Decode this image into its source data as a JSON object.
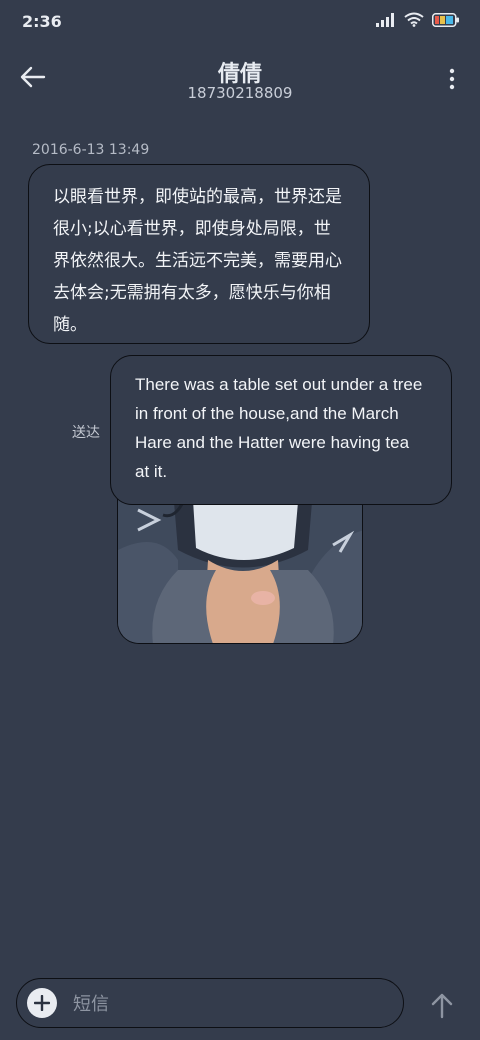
{
  "status_bar": {
    "time": "2:36"
  },
  "header": {
    "title": "倩倩",
    "subtitle": "18730218809"
  },
  "conversation": {
    "timestamp": "2016-6-13 13:49",
    "incoming_message": "以眼看世界，即使站的最高，世界还是很小;以心看世界，即使身处局限，世界依然很大。生活远不完美，需要用心去体会;无需拥有太多，愿快乐与你相随。",
    "outgoing_message": "There was a table set out under a tree in front of the house,and the March Hare and the Hatter were having tea at it.",
    "sent_status": "送达"
  },
  "composer": {
    "placeholder": "短信"
  },
  "icons": {
    "back": "arrow-left-icon",
    "more": "more-vertical-icon",
    "add": "plus-icon",
    "send": "arrow-up-icon",
    "signal": "signal-icon",
    "wifi": "wifi-icon",
    "battery": "battery-icon"
  },
  "colors": {
    "background": "#343c4c",
    "bubble_border": "#0d0f14",
    "text": "#f2f4f7"
  }
}
